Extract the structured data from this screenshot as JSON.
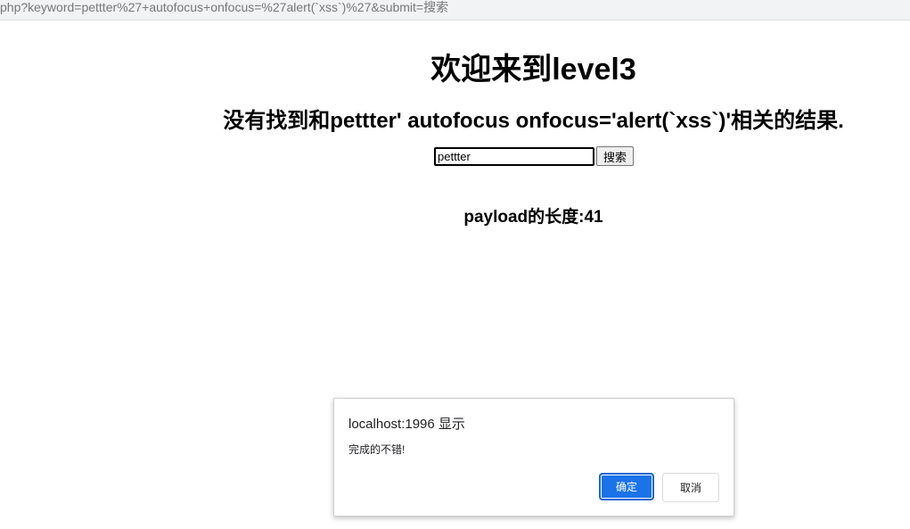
{
  "browser": {
    "url_visible": "php?keyword=pettter%27+autofocus+onfocus=%27alert(`xss`)%27&submit=搜索"
  },
  "page": {
    "heading": "欢迎来到level3",
    "result_message": "没有找到和pettter' autofocus onfocus='alert(`xss`)'相关的结果.",
    "search": {
      "input_value": "pettter",
      "button_label": "搜索"
    },
    "payload_length_text": "payload的长度:41"
  },
  "dialog": {
    "title": "localhost:1996 显示",
    "message": "完成的不错!",
    "ok_label": "确定",
    "cancel_label": "取消",
    "colors": {
      "ok_bg": "#1a73e8",
      "ok_text": "#ffffff"
    }
  }
}
